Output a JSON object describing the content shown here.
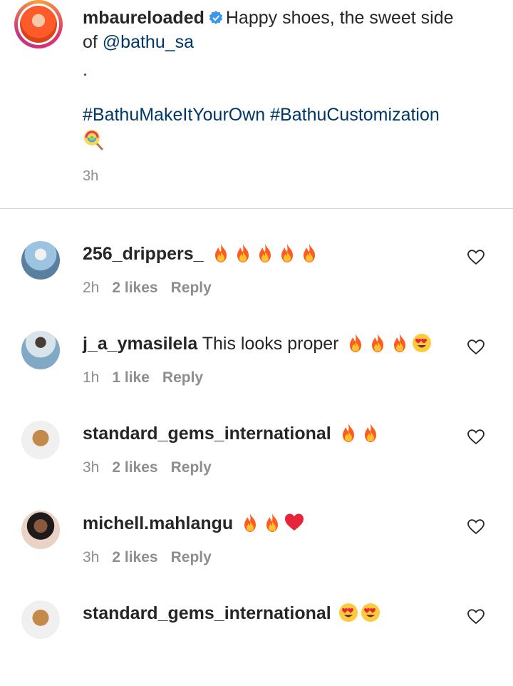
{
  "caption": {
    "username": "mbaureloaded",
    "text_part1": "Happy shoes, the sweet side",
    "text_part2_prefix": "of ",
    "mention": "@bathu_sa",
    "dot": ".",
    "hashtag1": "#BathuMakeItYourOwn",
    "hashtag2": "#BathuCustomization",
    "emoji": "lollipop-icon",
    "time": "3h"
  },
  "comments": [
    {
      "username": "256_drippers_",
      "text": "",
      "emojis": [
        "fire",
        "fire",
        "fire",
        "fire",
        "fire"
      ],
      "time": "2h",
      "likes": "2 likes",
      "reply": "Reply"
    },
    {
      "username": "j_a_ymasilela",
      "text": "This looks proper",
      "emojis": [
        "fire",
        "fire",
        "fire",
        "heart-eyes"
      ],
      "time": "1h",
      "likes": "1 like",
      "reply": "Reply"
    },
    {
      "username": "standard_gems_international",
      "text": "",
      "emojis": [
        "fire",
        "fire"
      ],
      "time": "3h",
      "likes": "2 likes",
      "reply": "Reply"
    },
    {
      "username": "michell.mahlangu",
      "text": "",
      "emojis": [
        "fire",
        "fire",
        "red-heart"
      ],
      "time": "3h",
      "likes": "2 likes",
      "reply": "Reply"
    },
    {
      "username": "standard_gems_international",
      "text": "",
      "emojis": [
        "heart-eyes",
        "heart-eyes"
      ],
      "time": "",
      "likes": "",
      "reply": ""
    }
  ],
  "colors": {
    "link": "#00376b",
    "muted": "#8e8e8e",
    "verified": "#3897f0",
    "fire": "#ff5a1f"
  }
}
